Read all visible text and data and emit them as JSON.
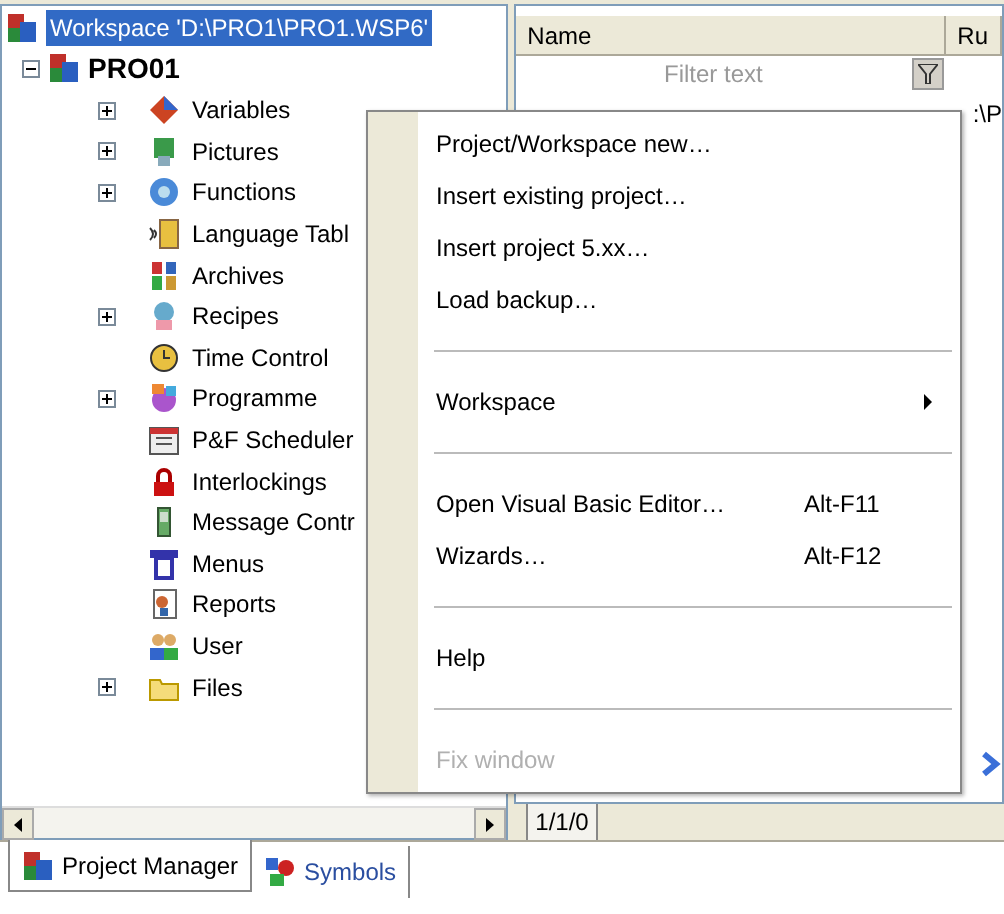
{
  "tree": {
    "label": "Workspace 'D:\\PRO1\\PRO1.WSP6'",
    "selected": true,
    "children": [
      {
        "label": "PRO01",
        "expanded": true,
        "children": [
          {
            "label": "Variables",
            "expandable": true
          },
          {
            "label": "Pictures",
            "expandable": true
          },
          {
            "label": "Functions",
            "expandable": true
          },
          {
            "label": "Language Tabl",
            "expandable": false
          },
          {
            "label": "Archives",
            "expandable": false
          },
          {
            "label": "Recipes",
            "expandable": true
          },
          {
            "label": "Time Control",
            "expandable": false
          },
          {
            "label": "Programme",
            "expandable": true
          },
          {
            "label": "P&F Scheduler",
            "expandable": false
          },
          {
            "label": "Interlockings",
            "expandable": false
          },
          {
            "label": "Message Contr",
            "expandable": false
          },
          {
            "label": "Menus",
            "expandable": false
          },
          {
            "label": "Reports",
            "expandable": false
          },
          {
            "label": "User",
            "expandable": false
          },
          {
            "label": "Files",
            "expandable": true
          }
        ]
      }
    ]
  },
  "list": {
    "columns": [
      "Name",
      "Ru"
    ],
    "filter_placeholder": "Filter text",
    "row_text": ":\\P",
    "position": "1/1/0"
  },
  "context_menu": [
    {
      "kind": "item",
      "label": "Project/Workspace new…",
      "disabled": false
    },
    {
      "kind": "item",
      "label": "Insert existing project…",
      "disabled": false
    },
    {
      "kind": "item",
      "label": "Insert project 5.xx…",
      "disabled": false
    },
    {
      "kind": "item",
      "label": "Load backup…",
      "disabled": false
    },
    {
      "kind": "separator"
    },
    {
      "kind": "submenu",
      "label": "Workspace",
      "disabled": false
    },
    {
      "kind": "separator"
    },
    {
      "kind": "item",
      "label": "Open Visual Basic Editor…",
      "shortcut": "Alt-F11",
      "disabled": false
    },
    {
      "kind": "item",
      "label": "Wizards…",
      "shortcut": "Alt-F12",
      "disabled": false
    },
    {
      "kind": "separator"
    },
    {
      "kind": "item",
      "label": "Help",
      "disabled": false
    },
    {
      "kind": "separator"
    },
    {
      "kind": "item",
      "label": "Fix window",
      "disabled": true
    }
  ],
  "tabs": [
    {
      "label": "Project Manager",
      "selected": true
    },
    {
      "label": "Symbols",
      "selected": false
    }
  ]
}
